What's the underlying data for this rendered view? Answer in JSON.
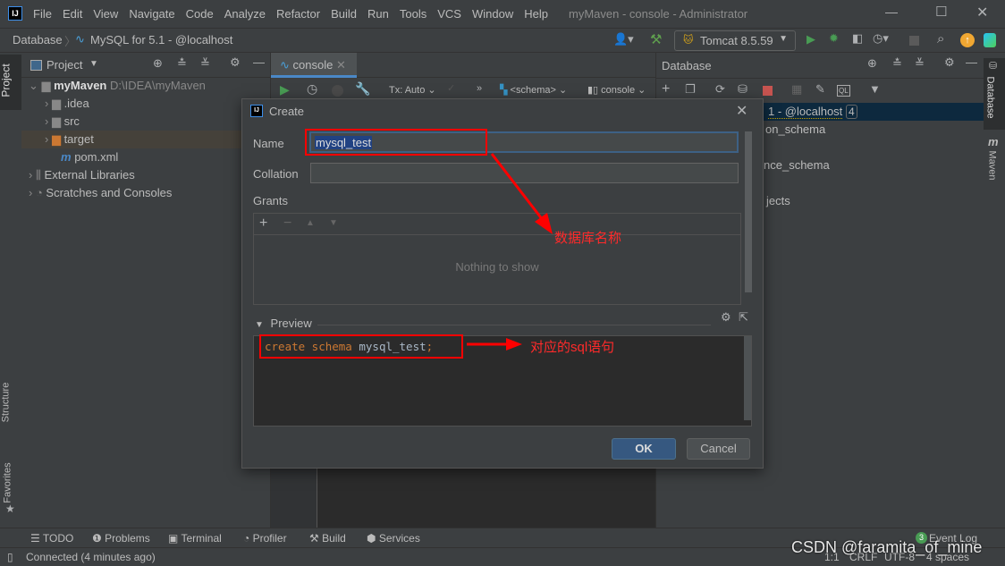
{
  "titlebar": {
    "menus": [
      "File",
      "Edit",
      "View",
      "Navigate",
      "Code",
      "Analyze",
      "Refactor",
      "Build",
      "Run",
      "Tools",
      "VCS",
      "Window",
      "Help"
    ],
    "title": "myMaven - console - Administrator"
  },
  "breadcrumb": {
    "items": [
      "Database",
      "MySQL for 5.1 - @localhost"
    ]
  },
  "toolbar": {
    "run_config": "Tomcat 8.5.59"
  },
  "left_stripe": {
    "project": "Project",
    "structure": "Structure",
    "favorites": "Favorites"
  },
  "right_stripe": {
    "database": "Database",
    "maven": "Maven"
  },
  "project": {
    "title": "Project",
    "root": "myMaven",
    "root_path": "D:\\IDEA\\myMaven",
    "items": [
      ".idea",
      "src",
      "target",
      "pom.xml",
      "External Libraries",
      "Scratches and Consoles"
    ]
  },
  "editor": {
    "tab": "console",
    "tx": "Tx: Auto",
    "schema": "<schema>",
    "session": "console"
  },
  "database": {
    "title": "Database",
    "rows": [
      "1 - @localhost",
      "on_schema",
      "nce_schema",
      "jects"
    ],
    "badge": "4"
  },
  "dialog": {
    "title": "Create",
    "name_label": "Name",
    "name_value": "mysql_test",
    "collation_label": "Collation",
    "collation_value": "",
    "grants_label": "Grants",
    "empty": "Nothing to show",
    "preview_label": "Preview",
    "sql_kw": "create schema",
    "sql_name": "mysql_test",
    "sql_end": ";",
    "ok": "OK",
    "cancel": "Cancel"
  },
  "annotations": {
    "name": "数据库名称",
    "sql": "对应的sql语句"
  },
  "bottom": {
    "tools": [
      "TODO",
      "Problems",
      "Terminal",
      "Profiler",
      "Build",
      "Services"
    ],
    "event_log": "Event Log",
    "event_count": "3",
    "status": "Connected (4 minutes ago)",
    "pos": "1:1",
    "eol": "CRLF",
    "enc": "UTF-8",
    "indent": "4 spaces",
    "watermark": "CSDN @faramita_of_mine"
  },
  "colors": {
    "accent": "#4a88c7",
    "selection": "#0d293e",
    "annotation": "#ff0000"
  }
}
